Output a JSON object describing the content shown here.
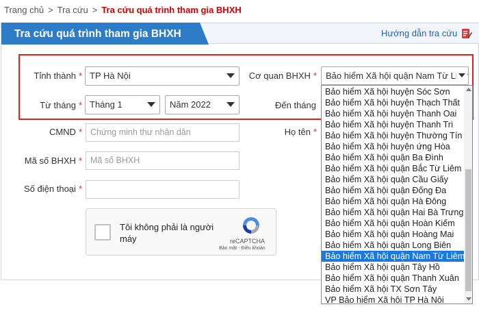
{
  "breadcrumb": {
    "items": [
      "Trang chủ",
      "Tra cứu"
    ],
    "separator": ">",
    "current": "Tra cứu quá trình tham gia BHXH"
  },
  "panel": {
    "title": "Tra cứu quá trình tham gia BHXH",
    "guide_link": "Hướng dẫn tra cứu",
    "guide_icon": "edit-document-icon"
  },
  "form": {
    "required_mark": "*",
    "province": {
      "label": "Tỉnh thành",
      "value": "TP Hà Nội"
    },
    "agency": {
      "label": "Cơ quan BHXH",
      "value": "Bảo hiểm Xã hội quận Nam Từ Liêm"
    },
    "from_month": {
      "label": "Từ tháng",
      "month": "Tháng 1",
      "year": "Năm 2022"
    },
    "to_month": {
      "label": "Đến tháng"
    },
    "id_card": {
      "label": "CMND",
      "placeholder": "Chứng minh thư nhân dân"
    },
    "full_name": {
      "label": "Họ tên"
    },
    "insurance_code": {
      "label": "Mã số BHXH",
      "placeholder": "Mã số BHXH"
    },
    "phone": {
      "label": "Số điện thoại",
      "value": ""
    }
  },
  "recaptcha": {
    "text": "Tôi không phải là người máy",
    "brand": "reCAPTCHA",
    "links": "Bảo mật - Điều khoản"
  },
  "agency_options": [
    "Bảo hiểm Xã hội huyện Sóc Sơn",
    "Bảo hiểm Xã hội huyện Thạch Thất",
    "Bảo hiểm Xã hội huyện Thanh Oai",
    "Bảo hiểm Xã hội huyện Thanh Trì",
    "Bảo hiểm Xã hội huyện Thường Tín",
    "Bảo hiểm Xã hội huyện ứng Hòa",
    "Bảo hiểm Xã hội quận Ba Đình",
    "Bảo hiểm Xã hội quận Bắc Từ Liêm",
    "Bảo hiểm Xã hội quận Cầu Giấy",
    "Bảo hiểm Xã hội quận Đống Đa",
    "Bảo hiểm Xã hội quận Hà Đông",
    "Bảo hiểm Xã hội quận Hai Bà Trưng",
    "Bảo hiểm Xã hội quận Hoàn Kiếm",
    "Bảo hiểm Xã hội quận Hoàng Mai",
    "Bảo hiểm Xã hội quận Long Biên",
    "Bảo hiểm Xã hội quận Nam Từ Liêm",
    "Bảo hiểm Xã hội quận Tây Hồ",
    "Bảo hiểm Xã hội quận Thanh Xuân",
    "Bảo hiểm Xã hội TX Sơn Tây",
    "VP Bảo hiểm Xã hội TP Hà Nội"
  ],
  "agency_selected_index": 15,
  "colors": {
    "accent": "#2e7bc6",
    "breadcrumb_current": "#cc0000",
    "required": "#dd3333",
    "highlight_box": "#e02020",
    "option_selected": "#1e78d7"
  }
}
